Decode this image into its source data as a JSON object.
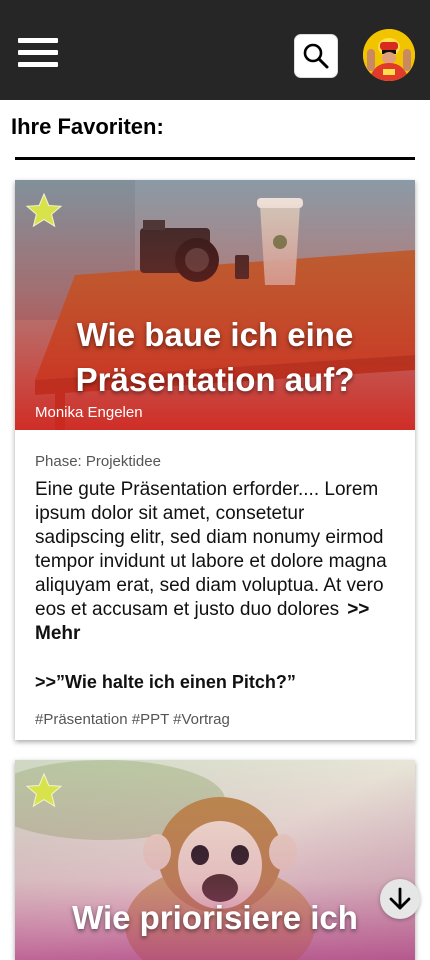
{
  "header": {
    "menu_icon": "hamburger-menu-icon",
    "search_icon": "search-icon",
    "avatar": "user-avatar"
  },
  "page": {
    "title": "Ihre Favoriten:"
  },
  "cards": [
    {
      "title": "Wie baue ich eine Präsentation auf?",
      "author": "Monika Engelen",
      "phase": "Phase: Projektidee",
      "excerpt": "Eine gute Präsentation erforder.... Lorem ipsum dolor sit amet, consetetur sadipscing elitr, sed diam nonumy eirmod tempor invidunt ut labore et dolore magna aliquyam erat, sed diam voluptua. At vero eos et accusam et justo duo dolores",
      "more_label": ">> Mehr",
      "related_label": ">>”Wie halte ich einen Pitch?”",
      "tags": "#Präsentation #PPT #Vortrag",
      "favorite": true
    },
    {
      "title": "Wie priorisiere ich",
      "favorite": true
    }
  ],
  "colors": {
    "header_bg": "#262626",
    "star": "#d8e24a",
    "card1_overlay": "#d0261f",
    "card2_overlay": "#c04a8a"
  },
  "scroll_icon": "arrow-down-icon"
}
